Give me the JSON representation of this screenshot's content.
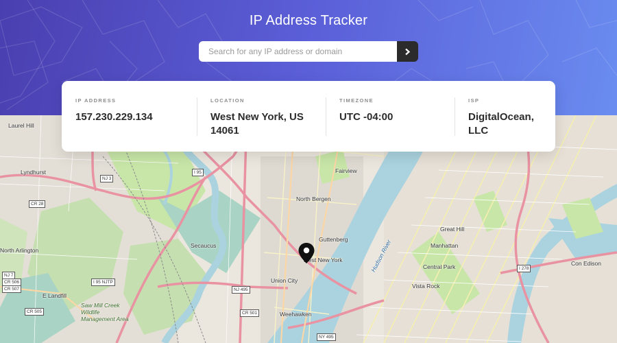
{
  "header": {
    "title": "IP Address Tracker"
  },
  "search": {
    "placeholder": "Search for any IP address or domain",
    "value": "",
    "submit_icon": "chevron-right-icon"
  },
  "info": [
    {
      "label": "IP Address",
      "value": "157.230.229.134"
    },
    {
      "label": "Location",
      "value": "West New York, US 14061"
    },
    {
      "label": "Timezone",
      "value": "UTC -04:00"
    },
    {
      "label": "ISP",
      "value": "DigitalOcean, LLC"
    }
  ],
  "map": {
    "marker_icon": "location-pin-icon",
    "places": [
      "Lyndhurst",
      "North Arlington",
      "Secaucus",
      "North Bergen",
      "Fairview",
      "Guttenberg",
      "West New York",
      "Union City",
      "Weehawken",
      "Manhattan",
      "Central Park",
      "Great Hill",
      "Vista Rock",
      "Con Edison",
      "E Landfill",
      "Saw Mill Creek Wildlife Management Area",
      "Hudson River",
      "Laurel Hill"
    ],
    "shields": [
      "NJ 3",
      "I 95",
      "CR 28",
      "NJ 7",
      "CR 506",
      "CR 507",
      "I 95 NJTP",
      "NJ 495",
      "CR 501",
      "NY 495",
      "I 278",
      "CR 505"
    ]
  },
  "colors": {
    "hero_start": "#4a3fb0",
    "hero_end": "#6a8cf0",
    "text_dark": "#2b2b2b",
    "label_gray": "#8c8c8c",
    "water": "#aad3df",
    "park": "#c8e6a8",
    "highway": "#e892a2"
  }
}
